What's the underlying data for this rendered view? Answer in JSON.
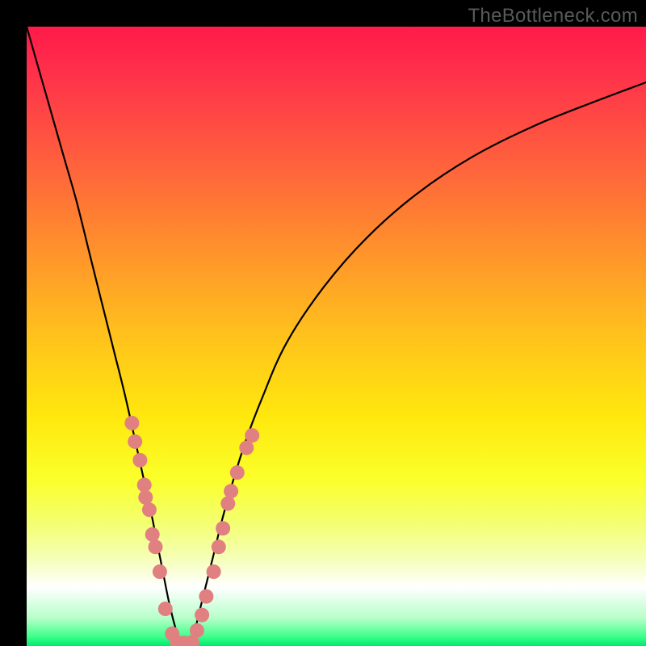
{
  "watermark": "TheBottleneck.com",
  "chart_data": {
    "type": "line",
    "title": "",
    "xlabel": "",
    "ylabel": "",
    "xlim": [
      0,
      100
    ],
    "ylim": [
      0,
      100
    ],
    "background_gradient": {
      "stops": [
        {
          "offset": 0.0,
          "color": "#ff1a4a"
        },
        {
          "offset": 0.07,
          "color": "#ff2f4b"
        },
        {
          "offset": 0.2,
          "color": "#ff5a3f"
        },
        {
          "offset": 0.35,
          "color": "#ff8e2d"
        },
        {
          "offset": 0.5,
          "color": "#ffc21c"
        },
        {
          "offset": 0.63,
          "color": "#ffe80e"
        },
        {
          "offset": 0.73,
          "color": "#fbff2a"
        },
        {
          "offset": 0.8,
          "color": "#f3ff6f"
        },
        {
          "offset": 0.86,
          "color": "#f5ffb9"
        },
        {
          "offset": 0.905,
          "color": "#ffffff"
        },
        {
          "offset": 0.955,
          "color": "#b6ffc9"
        },
        {
          "offset": 0.985,
          "color": "#3eff8a"
        },
        {
          "offset": 1.0,
          "color": "#00e86f"
        }
      ]
    },
    "series": [
      {
        "name": "bottleneck-curve",
        "x": [
          0,
          2,
          4,
          6,
          8,
          10,
          12,
          14,
          16,
          18,
          20,
          21,
          22,
          23,
          24,
          25,
          26,
          27,
          28,
          30,
          32,
          35,
          38,
          42,
          48,
          55,
          63,
          72,
          82,
          92,
          100
        ],
        "y": [
          100,
          93,
          86,
          79,
          72,
          64,
          56,
          48,
          40,
          31,
          22,
          17,
          12,
          7,
          3,
          0,
          0,
          2,
          6,
          14,
          22,
          32,
          40,
          49,
          58,
          66,
          73,
          79,
          84,
          88,
          91
        ]
      }
    ],
    "scatter_points": {
      "name": "sample-markers",
      "color": "#e08080",
      "radius_px": 9,
      "points": [
        {
          "x": 17.0,
          "y": 36.0
        },
        {
          "x": 17.5,
          "y": 33.0
        },
        {
          "x": 18.3,
          "y": 30.0
        },
        {
          "x": 19.0,
          "y": 26.0
        },
        {
          "x": 19.2,
          "y": 24.0
        },
        {
          "x": 19.8,
          "y": 22.0
        },
        {
          "x": 20.3,
          "y": 18.0
        },
        {
          "x": 20.8,
          "y": 16.0
        },
        {
          "x": 21.5,
          "y": 12.0
        },
        {
          "x": 22.4,
          "y": 6.0
        },
        {
          "x": 23.5,
          "y": 2.0
        },
        {
          "x": 24.3,
          "y": 0.6
        },
        {
          "x": 25.5,
          "y": 0.5
        },
        {
          "x": 26.7,
          "y": 0.6
        },
        {
          "x": 27.5,
          "y": 2.5
        },
        {
          "x": 28.3,
          "y": 5.0
        },
        {
          "x": 29.0,
          "y": 8.0
        },
        {
          "x": 30.2,
          "y": 12.0
        },
        {
          "x": 31.0,
          "y": 16.0
        },
        {
          "x": 31.7,
          "y": 19.0
        },
        {
          "x": 32.5,
          "y": 23.0
        },
        {
          "x": 33.0,
          "y": 25.0
        },
        {
          "x": 34.0,
          "y": 28.0
        },
        {
          "x": 35.5,
          "y": 32.0
        },
        {
          "x": 36.4,
          "y": 34.0
        }
      ]
    }
  }
}
